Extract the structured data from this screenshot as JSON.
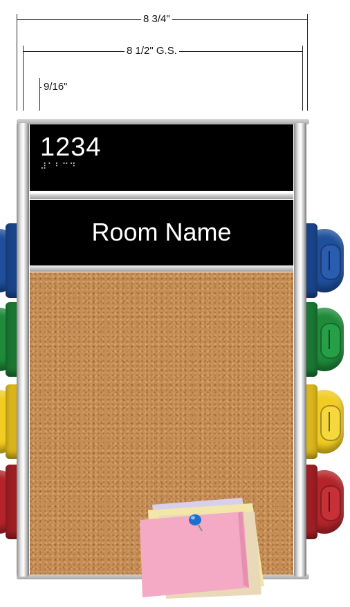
{
  "dimensions": {
    "overall_width": "8 3/4\"",
    "graphic_width": "8 1/2\" G.S.",
    "rail_inset": "9/16\""
  },
  "sign": {
    "room_number": "1234",
    "braille_label": "⠼⠁⠃⠉⠙",
    "room_name": "Room Name"
  },
  "flags": {
    "colors": [
      "#1f4f9c",
      "#1f8a3a",
      "#f2cc22",
      "#b5242a"
    ],
    "color_names": [
      "blue",
      "green",
      "yellow",
      "red"
    ]
  },
  "colors": {
    "panel": "#000000",
    "text": "#ffffff",
    "cork": "#c58d55",
    "note_pink": "#f4a9c4",
    "pin": "#1e6fd0"
  }
}
